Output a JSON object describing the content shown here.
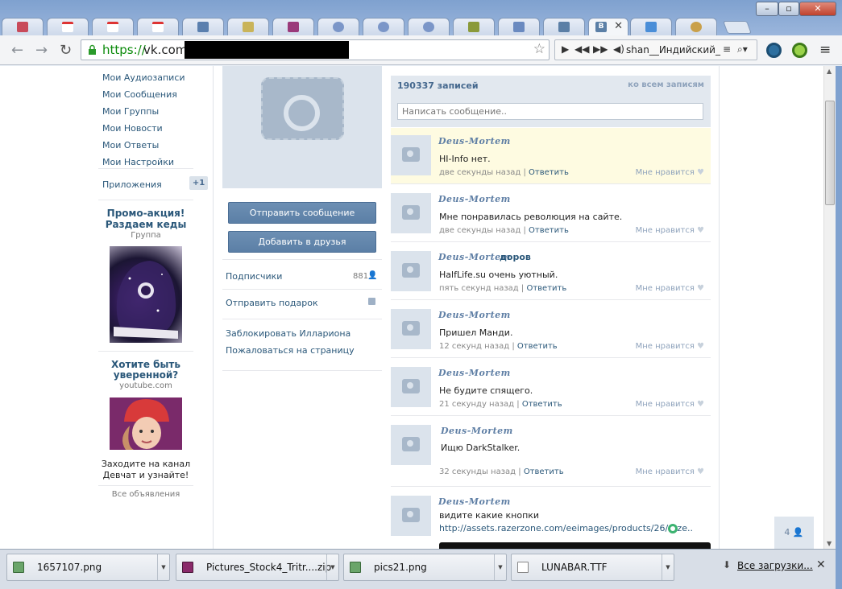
{
  "browser": {
    "url_scheme": "https://",
    "url_host": "vk.com/",
    "media_track": "shan__Индийский_",
    "active_tab_label": "В"
  },
  "left_nav": {
    "items": [
      "Мои Аудиозаписи",
      "Мои Сообщения",
      "Мои Группы",
      "Мои Новости",
      "Мои Ответы",
      "Мои Настройки"
    ],
    "apps": "Приложения",
    "apps_badge": "+1",
    "ad1": {
      "title_line1": "Промо-акция!",
      "title_line2": "Раздаем кеды",
      "subtitle": "Группа"
    },
    "ad2": {
      "title_line1": "Хотите быть",
      "title_line2": "уверенной?",
      "subtitle": "youtube.com",
      "text_line1": "Заходите на канал",
      "text_line2": "Девчат и узнайте!"
    },
    "all_ads": "Все объявления"
  },
  "profile": {
    "send_message": "Отправить сообщение",
    "add_friend": "Добавить в друзья",
    "subscribers": "Подписчики",
    "subscribers_count": "881",
    "send_gift": "Отправить подарок",
    "block": "Заблокировать Иллариона",
    "report": "Пожаловаться на страницу"
  },
  "wall": {
    "count": "190337 записей",
    "all_posts": "ко всем записям",
    "input_placeholder": "Написать сообщение..",
    "reply_label": "Ответить",
    "like_label": "Мне нравится",
    "posts": [
      {
        "author": "Deus-Mortem",
        "author_suffix": "",
        "text": "HI-Info нет.",
        "time": "две секунды назад"
      },
      {
        "author": "Deus-Mortem",
        "author_suffix": "",
        "text": "Мне понравилась революция на сайте.",
        "time": "две секунды назад"
      },
      {
        "author": "Deus-Mortem",
        "author_suffix": "доров",
        "text": "HalfLife.su очень уютный.",
        "time": "пять секунд назад"
      },
      {
        "author": "Deus-Mortem",
        "author_suffix": "",
        "text": "Пришел Манди.",
        "time": "12 секунд назад"
      },
      {
        "author": "Deus-Mortem",
        "author_suffix": "",
        "text": "Не будите спящего.",
        "time": "21 секунду назад"
      },
      {
        "author": "Deus-Mortem",
        "author_suffix": "",
        "text": "Ищю DarkStalker.",
        "time": "32 секунды назад"
      },
      {
        "author": "Deus-Mortem",
        "author_suffix": "",
        "text": "видите какие кнопки",
        "time": ""
      }
    ],
    "last_link": "http://assets.razerzone.com/eeimages/products/26/raze..",
    "side_count": "4"
  },
  "downloads": {
    "items": [
      "1657107.png",
      "Pictures_Stock4_Tritr....zip",
      "pics21.png",
      "LUNABAR.TTF"
    ],
    "all_label": "Все загрузки..."
  }
}
